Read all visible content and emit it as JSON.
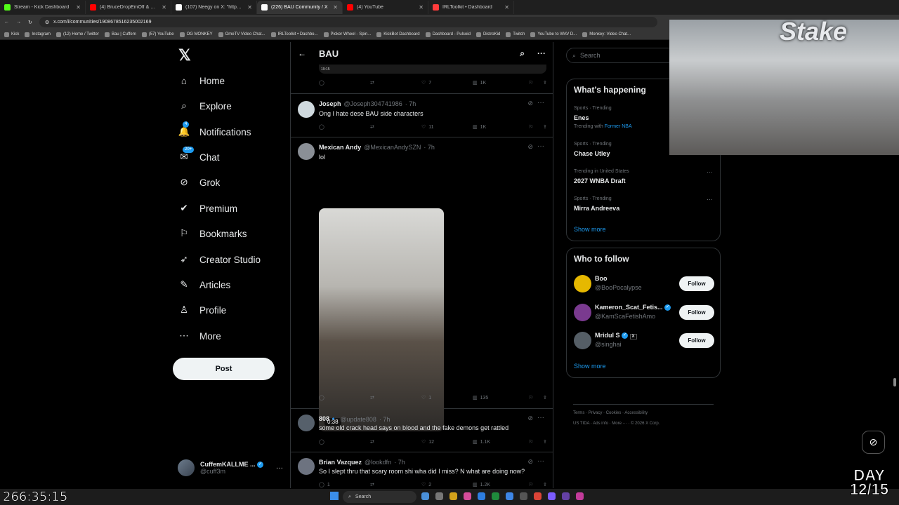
{
  "browser": {
    "tabs": [
      {
        "label": "Stream - Kick Dashboard",
        "color": "#53fc18"
      },
      {
        "label": "(4) BruceDropEmOff & Cuffem",
        "color": "#ff0000"
      },
      {
        "label": "(107) Neegy on X: \"https://t.co",
        "color": "#ffffff"
      },
      {
        "label": "(226) BAU Community / X",
        "color": "#ffffff",
        "active": true
      },
      {
        "label": "(4) YouTube",
        "color": "#ff0000"
      },
      {
        "label": "IRLToolkit • Dashboard",
        "color": "#ff3b3b"
      }
    ],
    "url": "x.com/i/communities/1908678516235002169",
    "bookmarks": [
      "Kick",
      "Instagram",
      "(12) Home / Twitter",
      "Bau | Cuffem",
      "(57) YouTube",
      "OG MONKEY",
      "OmeTV Video Chat...",
      "IRLToolkit • Dashbo...",
      "Picker Wheel - Spin...",
      "KickBot Dashboard",
      "Dashboard - Pulsoid",
      "DistroKid",
      "Twitch",
      "YouTube to WAV D...",
      "Monkey: Video Chat..."
    ]
  },
  "nav": {
    "items": [
      {
        "label": "Home",
        "icon": "home-icon",
        "glyph": "⌂"
      },
      {
        "label": "Explore",
        "icon": "search-icon",
        "glyph": "⌕"
      },
      {
        "label": "Notifications",
        "icon": "bell-icon",
        "glyph": "🔔",
        "badge": "4"
      },
      {
        "label": "Chat",
        "icon": "chat-icon",
        "glyph": "✉",
        "badge": "20+"
      },
      {
        "label": "Grok",
        "icon": "grok-icon",
        "glyph": "⊘"
      },
      {
        "label": "Premium",
        "icon": "premium-icon",
        "glyph": "✔"
      },
      {
        "label": "Bookmarks",
        "icon": "bookmark-icon",
        "glyph": "⚐"
      },
      {
        "label": "Creator Studio",
        "icon": "rocket-icon",
        "glyph": "➶"
      },
      {
        "label": "Articles",
        "icon": "article-icon",
        "glyph": "✎"
      },
      {
        "label": "Profile",
        "icon": "profile-icon",
        "glyph": "♙"
      },
      {
        "label": "More",
        "icon": "more-icon",
        "glyph": "⋯"
      }
    ],
    "post_label": "Post",
    "account": {
      "name": "CuffemKALLME ...",
      "handle": "@cuff3m"
    }
  },
  "feed": {
    "title": "BAU",
    "top_video_time": "19:15",
    "top_stats": {
      "reply": "",
      "retweet": "",
      "like": "7",
      "views": "1K"
    },
    "tweets": [
      {
        "name": "Joseph",
        "handle": "@Joseph304741986",
        "time": "· 7h",
        "text": "Ong I hate dese BAU side characters",
        "like": "11",
        "views": "1K",
        "avatar_color": "#cfd9de"
      },
      {
        "name": "Mexican Andy",
        "handle": "@MexicanAndySZN",
        "time": "· 7h",
        "text": "lol",
        "like": "1",
        "views": "135",
        "video_duration": "0:38",
        "avatar_color": "#8a8f96"
      },
      {
        "name": "808🔹",
        "handle": "@update808",
        "time": "· 7h",
        "text": "some old crack head says on blood and the fake demons  get rattled",
        "like": "12",
        "views": "1.1K",
        "avatar_color": "#56606b"
      },
      {
        "name": "Brian Vazquez",
        "handle": "@lookdfn",
        "time": "· 7h",
        "text": "So I slept thru that scary room shi wha did I miss? N what are doing now?",
        "like": "2",
        "views": "1.2K",
        "reply": "1",
        "avatar_color": "#6d7380"
      }
    ]
  },
  "sidebar": {
    "search_placeholder": "Search",
    "whats_happening": {
      "title": "What’s happening",
      "trends": [
        {
          "meta": "Sports · Trending",
          "name": "Enes",
          "sub_prefix": "Trending with",
          "sub_link": "Former NBA"
        },
        {
          "meta": "Sports · Trending",
          "name": "Chase Utley"
        },
        {
          "meta": "Trending in United States",
          "name": "2027 WNBA Draft"
        },
        {
          "meta": "Sports · Trending",
          "name": "Mirra Andreeva"
        }
      ],
      "show_more": "Show more"
    },
    "who_to_follow": {
      "title": "Who to follow",
      "users": [
        {
          "name": "Boo",
          "handle": "@BooPocalypse",
          "color": "#e6b800"
        },
        {
          "name": "Kameron_Scat_Fetis...",
          "handle": "@KamScaFetishAmo",
          "color": "#7a3a8f"
        },
        {
          "name": "Mridul S",
          "handle": "@singhai",
          "color": "#555e66"
        }
      ],
      "follow_label": "Follow",
      "show_more": "Show more"
    },
    "footer": {
      "line1": [
        "Terms",
        "Privacy",
        "Cookies",
        "Accessibility"
      ],
      "line2": [
        "US TIDA",
        "Ads info",
        "More ···",
        "© 2026 X Corp."
      ]
    }
  },
  "overlay": {
    "brand": "Stake",
    "day_label": "DAY",
    "day_value": "12/15",
    "timer": "266:35:15",
    "taskbar_search": "Search"
  }
}
